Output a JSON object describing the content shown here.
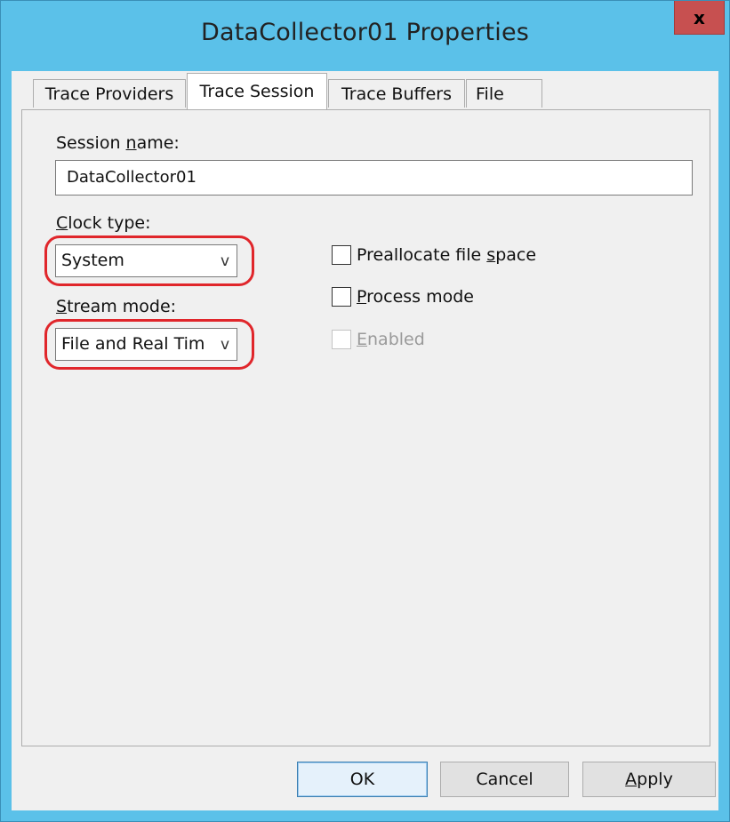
{
  "window": {
    "title": "DataCollector01 Properties",
    "close_label": "x"
  },
  "tabs": [
    {
      "label": "Trace Providers",
      "active": false
    },
    {
      "label": "Trace Session",
      "active": true
    },
    {
      "label": "Trace Buffers",
      "active": false
    },
    {
      "label": "File",
      "active": false
    }
  ],
  "session_name": {
    "label_pre": "Session ",
    "label_key": "n",
    "label_post": "ame:",
    "value": "DataCollector01"
  },
  "clock_type": {
    "label_key": "C",
    "label_post": "lock type:",
    "value": "System",
    "arrow": "v"
  },
  "stream_mode": {
    "label_key": "S",
    "label_post": "tream mode:",
    "value": "File and Real Tim",
    "arrow": "v"
  },
  "checkboxes": {
    "preallocate": {
      "pre": "Preallocate file ",
      "key": "s",
      "post": "pace",
      "checked": false,
      "enabled": true
    },
    "process_mode": {
      "key": "P",
      "post": "rocess mode",
      "checked": false,
      "enabled": true
    },
    "enabled": {
      "key": "E",
      "post": "nabled",
      "checked": false,
      "enabled": false
    }
  },
  "buttons": {
    "ok": "OK",
    "cancel": "Cancel",
    "apply_key": "A",
    "apply_post": "pply"
  },
  "colors": {
    "title_bar": "#5bc1e9",
    "close_button": "#c75050",
    "highlight": "#e0262b",
    "dialog_bg": "#f0f0f0"
  }
}
